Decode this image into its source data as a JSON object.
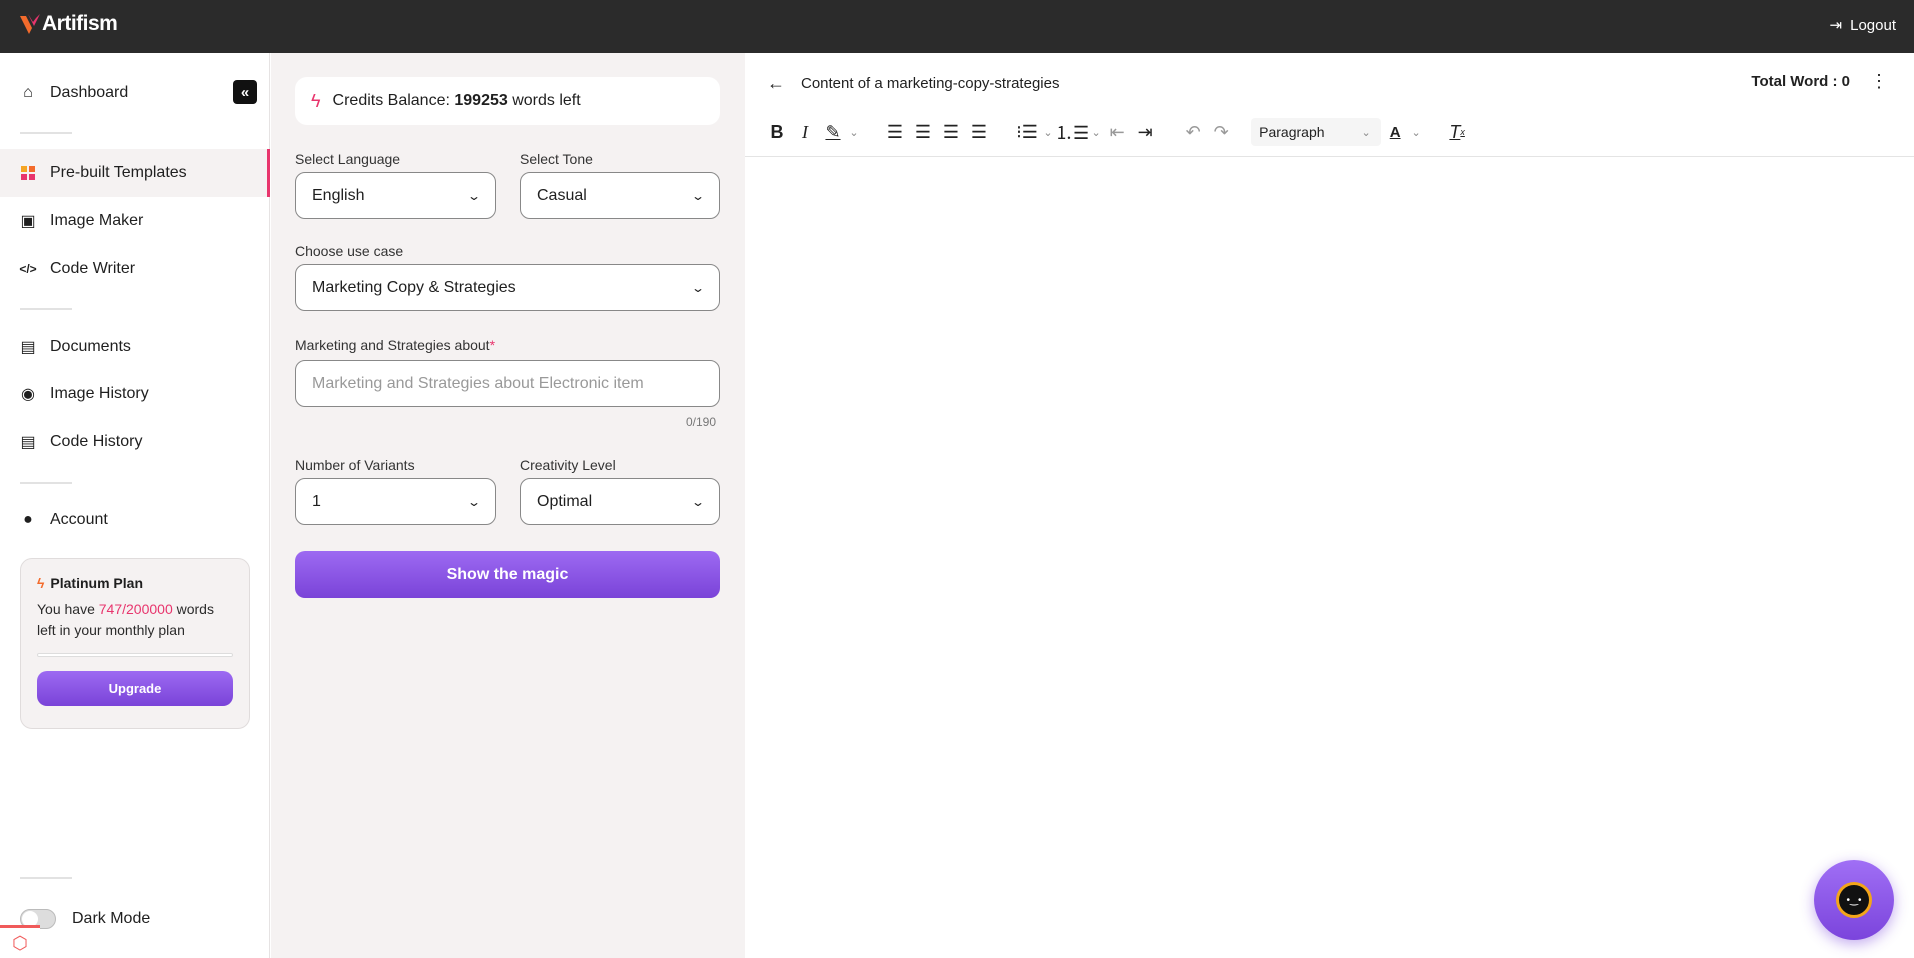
{
  "header": {
    "brand": "Artifism",
    "logout": "Logout"
  },
  "sidebar": {
    "items": [
      {
        "label": "Dashboard",
        "icon": "home-icon"
      },
      {
        "label": "Pre-built Templates",
        "icon": "templates-icon"
      },
      {
        "label": "Image Maker",
        "icon": "image-icon"
      },
      {
        "label": "Code Writer",
        "icon": "code-icon"
      },
      {
        "label": "Documents",
        "icon": "document-icon"
      },
      {
        "label": "Image History",
        "icon": "history-icon"
      },
      {
        "label": "Code History",
        "icon": "code-file-icon"
      },
      {
        "label": "Account",
        "icon": "user-icon"
      }
    ],
    "plan": {
      "title": "Platinum Plan",
      "text_before": "You have ",
      "usage": "747/200000",
      "text_after": " words left in your monthly plan",
      "progress": 0.004,
      "upgrade": "Upgrade"
    },
    "dark_mode": "Dark Mode"
  },
  "form": {
    "credits_label": "Credits Balance: ",
    "credits_value": "199253",
    "credits_suffix": " words left",
    "language_label": "Select Language",
    "language": "English",
    "tone_label": "Select Tone",
    "tone": "Casual",
    "use_case_label": "Choose use case",
    "use_case": "Marketing Copy & Strategies",
    "about_label": "Marketing and Strategies about",
    "required": "*",
    "about_placeholder": "Marketing and Strategies about Electronic item",
    "char_count": "0/190",
    "variants_label": "Number of Variants",
    "variants": "1",
    "creativity_label": "Creativity Level",
    "creativity": "Optimal",
    "submit": "Show the magic"
  },
  "editor": {
    "title": "Content of a marketing-copy-strategies",
    "total_word": "Total Word : 0",
    "block_format": "Paragraph"
  },
  "colors": {
    "accent": "#8b57e8",
    "highlight": "#e8356d",
    "topbar": "#2b2b2b"
  }
}
